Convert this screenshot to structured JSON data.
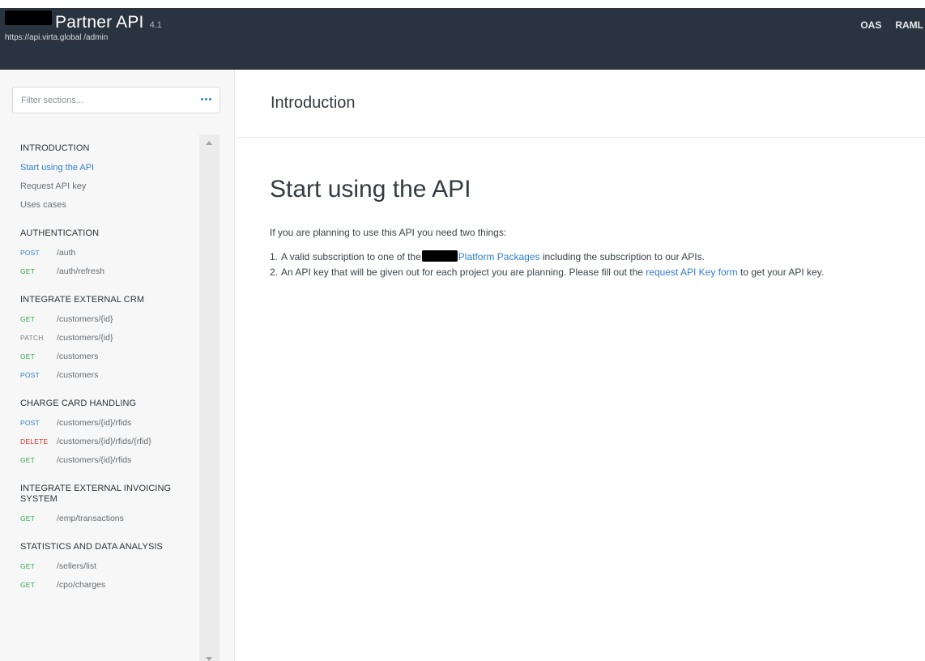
{
  "header": {
    "title": "Partner API",
    "version": "4.1",
    "base_url": "https://api.virta.global /admin",
    "links": [
      "OAS",
      "RAML"
    ]
  },
  "sidebar": {
    "filter_placeholder": "Filter sections...",
    "sections": [
      {
        "title": "INTRODUCTION",
        "links": [
          "Start using the API",
          "Request API key",
          "Uses cases"
        ]
      },
      {
        "title": "AUTHENTICATION",
        "endpoints": [
          {
            "method": "POST",
            "path": "/auth"
          },
          {
            "method": "GET",
            "path": "/auth/refresh"
          }
        ]
      },
      {
        "title": "INTEGRATE EXTERNAL CRM",
        "endpoints": [
          {
            "method": "GET",
            "path": "/customers/{id}"
          },
          {
            "method": "PATCH",
            "path": "/customers/{id}"
          },
          {
            "method": "GET",
            "path": "/customers"
          },
          {
            "method": "POST",
            "path": "/customers"
          }
        ]
      },
      {
        "title": "CHARGE CARD HANDLING",
        "endpoints": [
          {
            "method": "POST",
            "path": "/customers/{id}/rfids"
          },
          {
            "method": "DELETE",
            "path": "/customers/{id}/rfids/{rfid}"
          },
          {
            "method": "GET",
            "path": "/customers/{id}/rfids"
          }
        ]
      },
      {
        "title": "INTEGRATE EXTERNAL INVOICING SYSTEM",
        "endpoints": [
          {
            "method": "GET",
            "path": "/emp/transactions"
          }
        ]
      },
      {
        "title": "STATISTICS AND DATA ANALYSIS",
        "endpoints": [
          {
            "method": "GET",
            "path": "/sellers/list"
          },
          {
            "method": "GET",
            "path": "/cpo/charges"
          }
        ]
      }
    ]
  },
  "main": {
    "section_title": "Introduction",
    "heading": "Start using the API",
    "intro": "If you are planning to use this API you need two things:",
    "steps": [
      {
        "num": "1.",
        "before": "A valid subscription to one of the",
        "link": "Platform Packages",
        "after": " including the subscription to our APIs."
      },
      {
        "num": "2.",
        "before": "An API key that will be given out for each project you are planning. Please fill out the ",
        "link": "request API Key form",
        "after": " to get your API key."
      }
    ]
  },
  "colors": {
    "header_bg": "#2a3440",
    "accent_blue": "#2f7fd1",
    "get_green": "#2eaa4e",
    "delete_red": "#d5322a"
  }
}
